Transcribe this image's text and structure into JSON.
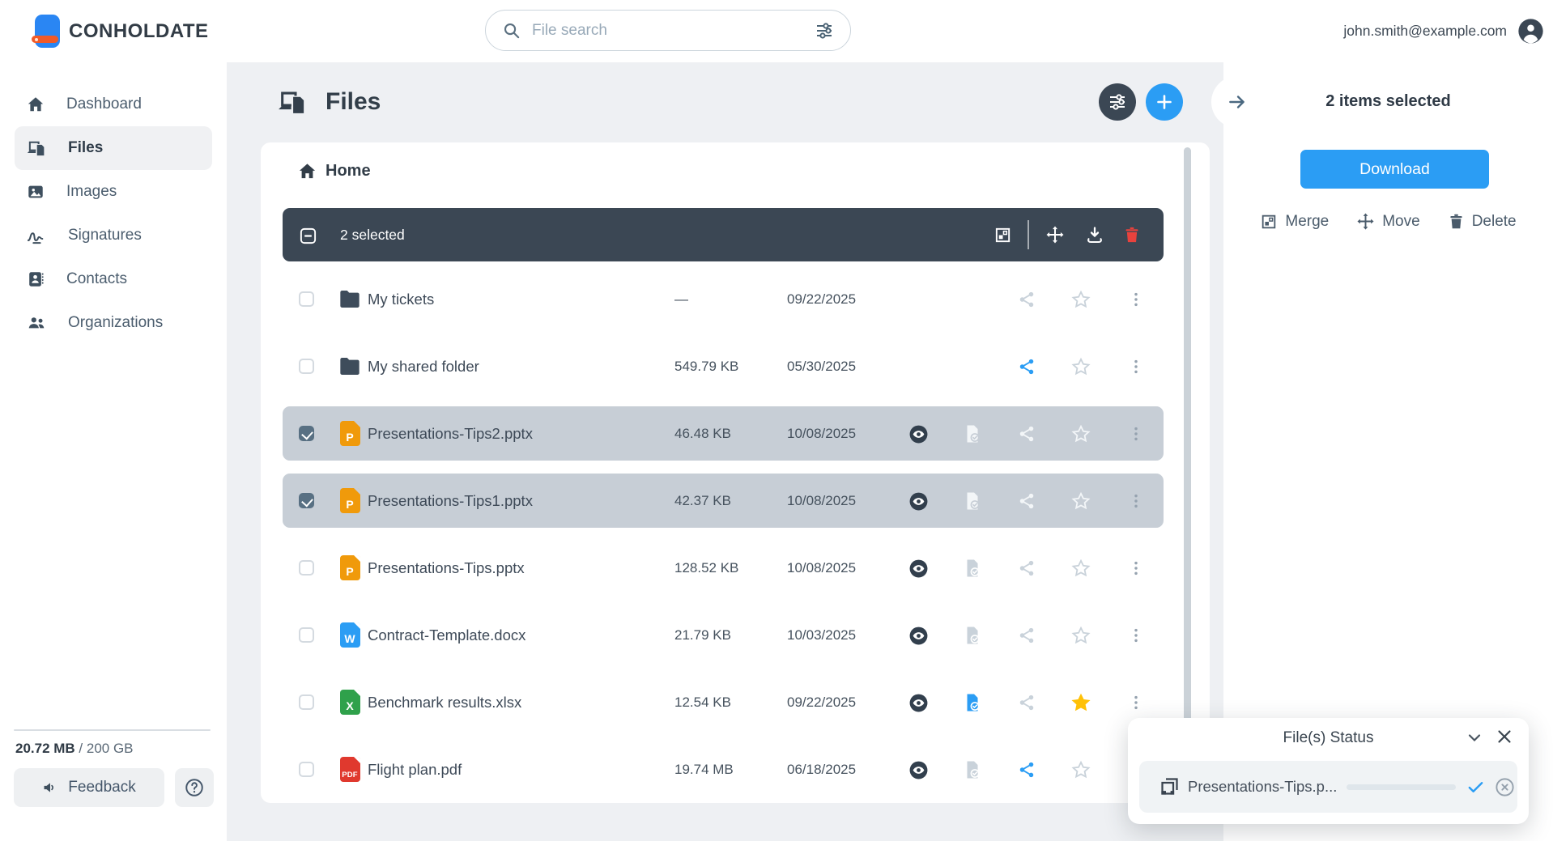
{
  "topbar": {
    "brand": "CONHOLDATE",
    "search_placeholder": "File search",
    "user_email": "john.smith@example.com"
  },
  "sidebar": {
    "items": [
      {
        "label": "Dashboard",
        "icon": "home",
        "active": false
      },
      {
        "label": "Files",
        "icon": "files",
        "active": true
      },
      {
        "label": "Images",
        "icon": "images",
        "active": false
      },
      {
        "label": "Signatures",
        "icon": "signature",
        "active": false
      },
      {
        "label": "Contacts",
        "icon": "contact-card",
        "active": false
      },
      {
        "label": "Organizations",
        "icon": "people",
        "active": false
      }
    ],
    "storage": {
      "used": "20.72 MB",
      "separator": " / ",
      "total": "200 GB"
    },
    "feedback_label": "Feedback"
  },
  "main": {
    "title": "Files",
    "breadcrumb": "Home",
    "selection_toolbar": {
      "selected_label": "2 selected"
    },
    "rows": [
      {
        "name": "My tickets",
        "type": "folder",
        "badge": "",
        "size": "—",
        "date": "09/22/2025",
        "checked": false,
        "selected": false,
        "eye": false,
        "filecheck": "none",
        "share": "inactive",
        "star": "inactive"
      },
      {
        "name": "My shared folder",
        "type": "folder",
        "badge": "",
        "size": "549.79 KB",
        "date": "05/30/2025",
        "checked": false,
        "selected": false,
        "eye": false,
        "filecheck": "none",
        "share": "active",
        "star": "inactive"
      },
      {
        "name": "Presentations-Tips2.pptx",
        "type": "pptx",
        "badge": "P",
        "size": "46.48 KB",
        "date": "10/08/2025",
        "checked": true,
        "selected": true,
        "eye": true,
        "filecheck": "inactive",
        "share": "inactive",
        "star": "inactive"
      },
      {
        "name": "Presentations-Tips1.pptx",
        "type": "pptx",
        "badge": "P",
        "size": "42.37 KB",
        "date": "10/08/2025",
        "checked": true,
        "selected": true,
        "eye": true,
        "filecheck": "inactive",
        "share": "inactive",
        "star": "inactive"
      },
      {
        "name": "Presentations-Tips.pptx",
        "type": "pptx",
        "badge": "P",
        "size": "128.52 KB",
        "date": "10/08/2025",
        "checked": false,
        "selected": false,
        "eye": true,
        "filecheck": "inactive",
        "share": "inactive",
        "star": "inactive"
      },
      {
        "name": "Contract-Template.docx",
        "type": "docx",
        "badge": "W",
        "size": "21.79 KB",
        "date": "10/03/2025",
        "checked": false,
        "selected": false,
        "eye": true,
        "filecheck": "inactive",
        "share": "inactive",
        "star": "inactive"
      },
      {
        "name": "Benchmark results.xlsx",
        "type": "xlsx",
        "badge": "X",
        "size": "12.54 KB",
        "date": "09/22/2025",
        "checked": false,
        "selected": false,
        "eye": true,
        "filecheck": "active",
        "share": "inactive",
        "star": "active"
      },
      {
        "name": "Flight plan.pdf",
        "type": "pdf",
        "badge": "PDF",
        "size": "19.74 MB",
        "date": "06/18/2025",
        "checked": false,
        "selected": false,
        "eye": true,
        "filecheck": "inactive",
        "share": "active",
        "star": "inactive"
      }
    ]
  },
  "right_panel": {
    "selected_label": "2 items selected",
    "download_label": "Download",
    "actions": [
      {
        "label": "Merge",
        "icon": "merge"
      },
      {
        "label": "Move",
        "icon": "move"
      },
      {
        "label": "Delete",
        "icon": "trash"
      }
    ]
  },
  "status_panel": {
    "title": "File(s) Status",
    "item": {
      "file_name": "Presentations-Tips.p...",
      "progress_percent": 100,
      "status": "complete"
    }
  },
  "colors": {
    "accent_blue": "#2b9df4",
    "toolbar_bg": "#3b4754",
    "selected_row_bg": "#c7ced6",
    "star_gold": "#ffc107",
    "delete_red": "#e8423d",
    "pptx_orange": "#f09a0b",
    "docx_blue": "#2b9df4",
    "xlsx_green": "#2fa14b",
    "pdf_red": "#e0392e"
  }
}
